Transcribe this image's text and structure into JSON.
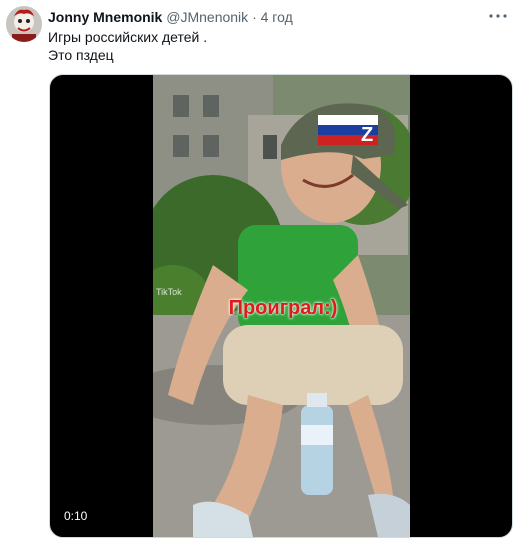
{
  "tweet": {
    "display_name": "Jonny Mnemonik",
    "handle": "@JMnenonik",
    "separator": "·",
    "time": "4 год",
    "text_lines": [
      "Игры российских детей .",
      "Это пздец"
    ]
  },
  "media": {
    "caption_overlay": "Проиграл:)",
    "watermark": "TikTok",
    "duration": "0:10"
  },
  "icons": {
    "more": "more-horizontal-icon"
  }
}
